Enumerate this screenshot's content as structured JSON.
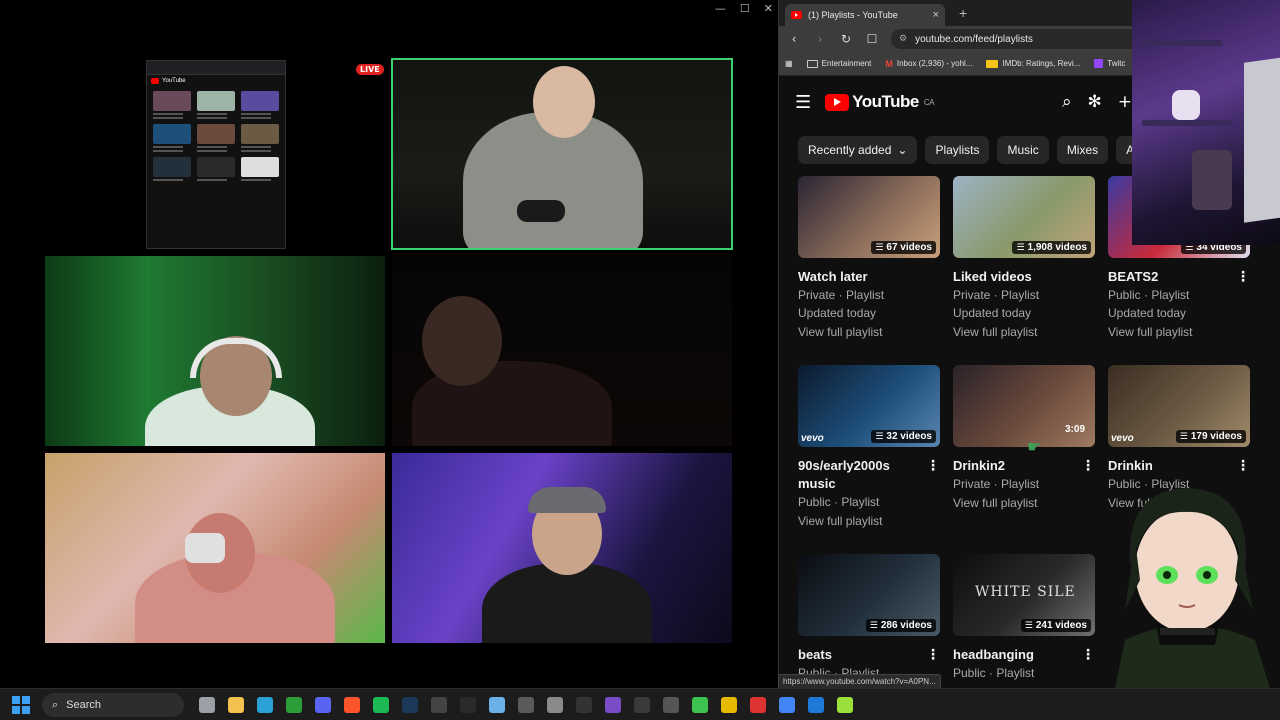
{
  "call": {
    "window_controls": [
      "—",
      "☐",
      "✕"
    ],
    "live_badge": "LIVE",
    "mini_share_logo": "YouTube"
  },
  "browser": {
    "tab_title": "(1) Playlists - YouTube",
    "tab_close": "×",
    "new_tab": "+",
    "nav": {
      "back": "‹",
      "forward": "›",
      "reload": "↻",
      "bookmark": "☐"
    },
    "url": "youtube.com/feed/playlists",
    "bookmarks": [
      {
        "label": "Entertainment",
        "icon": "folder-icon"
      },
      {
        "label": "Inbox (2,936) - yohl...",
        "icon": "gmail-icon"
      },
      {
        "label": "IMDb: Ratings, Revi...",
        "icon": "imdb-icon"
      },
      {
        "label": "Twitc",
        "icon": "twitch-icon"
      }
    ]
  },
  "youtube": {
    "logo_text": "YouTube",
    "region": "CA",
    "chips": [
      {
        "label": "Recently added",
        "dropdown": true
      },
      {
        "label": "Playlists",
        "dropdown": false
      },
      {
        "label": "Music",
        "dropdown": false
      },
      {
        "label": "Mixes",
        "dropdown": false
      },
      {
        "label": "Alb",
        "dropdown": false
      }
    ],
    "playlists": [
      {
        "title": "Watch later",
        "count": "67 videos",
        "privacy": "Private · Playlist",
        "updated": "Updated today",
        "view": "View full playlist",
        "thumb": [
          "#2a2433",
          "#8a6b5a",
          "#c9a07a"
        ],
        "overlay": "",
        "kebab": false
      },
      {
        "title": "Liked videos",
        "count": "1,908 videos",
        "privacy": "Private · Playlist",
        "updated": "Updated today",
        "view": "View full playlist",
        "thumb": [
          "#9db3c6",
          "#8a9a6a",
          "#c0a37a"
        ],
        "overlay": "",
        "kebab": false
      },
      {
        "title": "BEATS2",
        "count": "34 videos",
        "privacy": "Public · Playlist",
        "updated": "Updated today",
        "view": "View full playlist",
        "thumb": [
          "#3a3aa0",
          "#c82a3a",
          "#e0e0f0"
        ],
        "overlay": "",
        "kebab": true
      },
      {
        "title": "90s/early2000s music",
        "count": "32 videos",
        "privacy": "Public · Playlist",
        "updated": "",
        "view": "View full playlist",
        "thumb": [
          "#0c1a2e",
          "#1d4f7a",
          "#5a86b0"
        ],
        "overlay": "vevo",
        "kebab": true
      },
      {
        "title": "Drinkin2",
        "count": "",
        "duration": "3:09",
        "privacy": "Private · Playlist",
        "updated": "",
        "view": "View full playlist",
        "thumb": [
          "#2a2228",
          "#6b4a3c",
          "#a07a60"
        ],
        "overlay": "",
        "kebab": true
      },
      {
        "title": "Drinkin",
        "count": "179 videos",
        "privacy": "Public · Playlist",
        "updated": "",
        "view": "View full playlist",
        "thumb": [
          "#3a2e22",
          "#6b5a44",
          "#a08a6a"
        ],
        "overlay": "vevo",
        "kebab": true
      },
      {
        "title": "beats",
        "count": "286 videos",
        "privacy": "Public · Playlist",
        "updated": "",
        "view": "",
        "thumb": [
          "#0a0d12",
          "#22303c",
          "#4a5a66"
        ],
        "overlay": "",
        "kebab": true
      },
      {
        "title": "headbanging",
        "count": "241 videos",
        "privacy": "Public · Playlist",
        "updated": "",
        "view": "",
        "thumb": [
          "#0d0d0d",
          "#2a2a2a",
          "#707070"
        ],
        "overlay": "WHITE SILE",
        "kebab": true
      }
    ]
  },
  "status_url": "https://www.youtube.com/watch?v=A0PN...",
  "taskbar": {
    "search_placeholder": "Search",
    "apps": [
      {
        "name": "task-view-icon",
        "color": "#9aa0a6"
      },
      {
        "name": "file-explorer-icon",
        "color": "#f2c14e"
      },
      {
        "name": "edge-icon",
        "color": "#2aa1d6"
      },
      {
        "name": "xbox-icon",
        "color": "#2e9e3a"
      },
      {
        "name": "discord-icon",
        "color": "#5865f2"
      },
      {
        "name": "brave-icon",
        "color": "#fb542b"
      },
      {
        "name": "spotify-icon",
        "color": "#1db954"
      },
      {
        "name": "steam-icon",
        "color": "#1b3a5a"
      },
      {
        "name": "obs-icon",
        "color": "#444"
      },
      {
        "name": "epic-games-icon",
        "color": "#2a2a2a"
      },
      {
        "name": "notepad-icon",
        "color": "#6ab0e8"
      },
      {
        "name": "calculator-icon",
        "color": "#5a5a5a"
      },
      {
        "name": "settings-icon",
        "color": "#8a8a8a"
      },
      {
        "name": "terminal-icon",
        "color": "#333"
      },
      {
        "name": "clipchamp-icon",
        "color": "#7b4cc8"
      },
      {
        "name": "media-icon",
        "color": "#3a3a3a"
      },
      {
        "name": "camera-icon",
        "color": "#555"
      },
      {
        "name": "play-green-icon",
        "color": "#3cc24e"
      },
      {
        "name": "chrome-icon",
        "color": "#e6b800"
      },
      {
        "name": "vivaldi-icon",
        "color": "#d33"
      },
      {
        "name": "chrome-2-icon",
        "color": "#4285f4"
      },
      {
        "name": "blue-app-icon",
        "color": "#1e78d6"
      },
      {
        "name": "play-lime-icon",
        "color": "#9adf3a"
      }
    ]
  }
}
